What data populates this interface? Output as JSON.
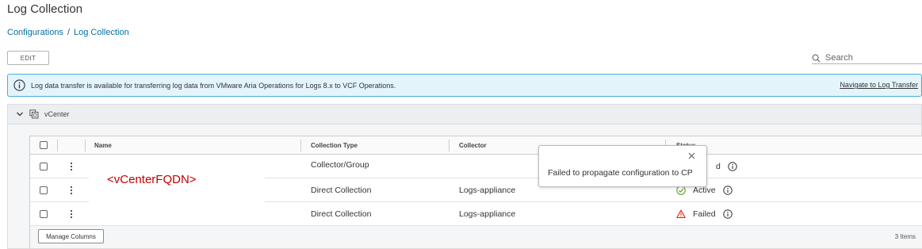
{
  "page": {
    "title": "Log Collection"
  },
  "breadcrumb": {
    "items": [
      "Configurations",
      "Log Collection"
    ],
    "separator": "/"
  },
  "toolbar": {
    "edit_label": "EDIT",
    "search_placeholder": "Search"
  },
  "banner": {
    "message": "Log data transfer is available for transferring log data from VMware Aria Operations for Logs 8.x to VCF Operations.",
    "link_label": "Navigate to Log Transfer",
    "icon": "info-icon"
  },
  "group": {
    "label": "vCenter",
    "icon": "vcenter-icon",
    "expanded": true
  },
  "grid": {
    "columns": [
      "Name",
      "Collection Type",
      "Collector",
      "Status"
    ],
    "rows": [
      {
        "name": "",
        "collection_type": "Collector/Group",
        "collector": "",
        "status": ""
      },
      {
        "name": "",
        "collection_type": "Direct Collection",
        "collector": "Logs-appliance",
        "status": "Active"
      },
      {
        "name": "",
        "collection_type": "Direct Collection",
        "collector": "Logs-appliance",
        "status": "Failed"
      }
    ],
    "name_overlay": "<vCenterFQDN>",
    "footer": {
      "manage_columns_label": "Manage Columns",
      "item_count": "3 Items"
    }
  },
  "popover": {
    "message": "Failed to propagate configuration to CP",
    "partial_status_text": "d"
  },
  "colors": {
    "link": "#0072a3",
    "banner_bg": "#e3f4fb",
    "banner_border": "#49afd9",
    "success": "#5aa220",
    "danger": "#e12200",
    "annotation": "#c00000"
  }
}
